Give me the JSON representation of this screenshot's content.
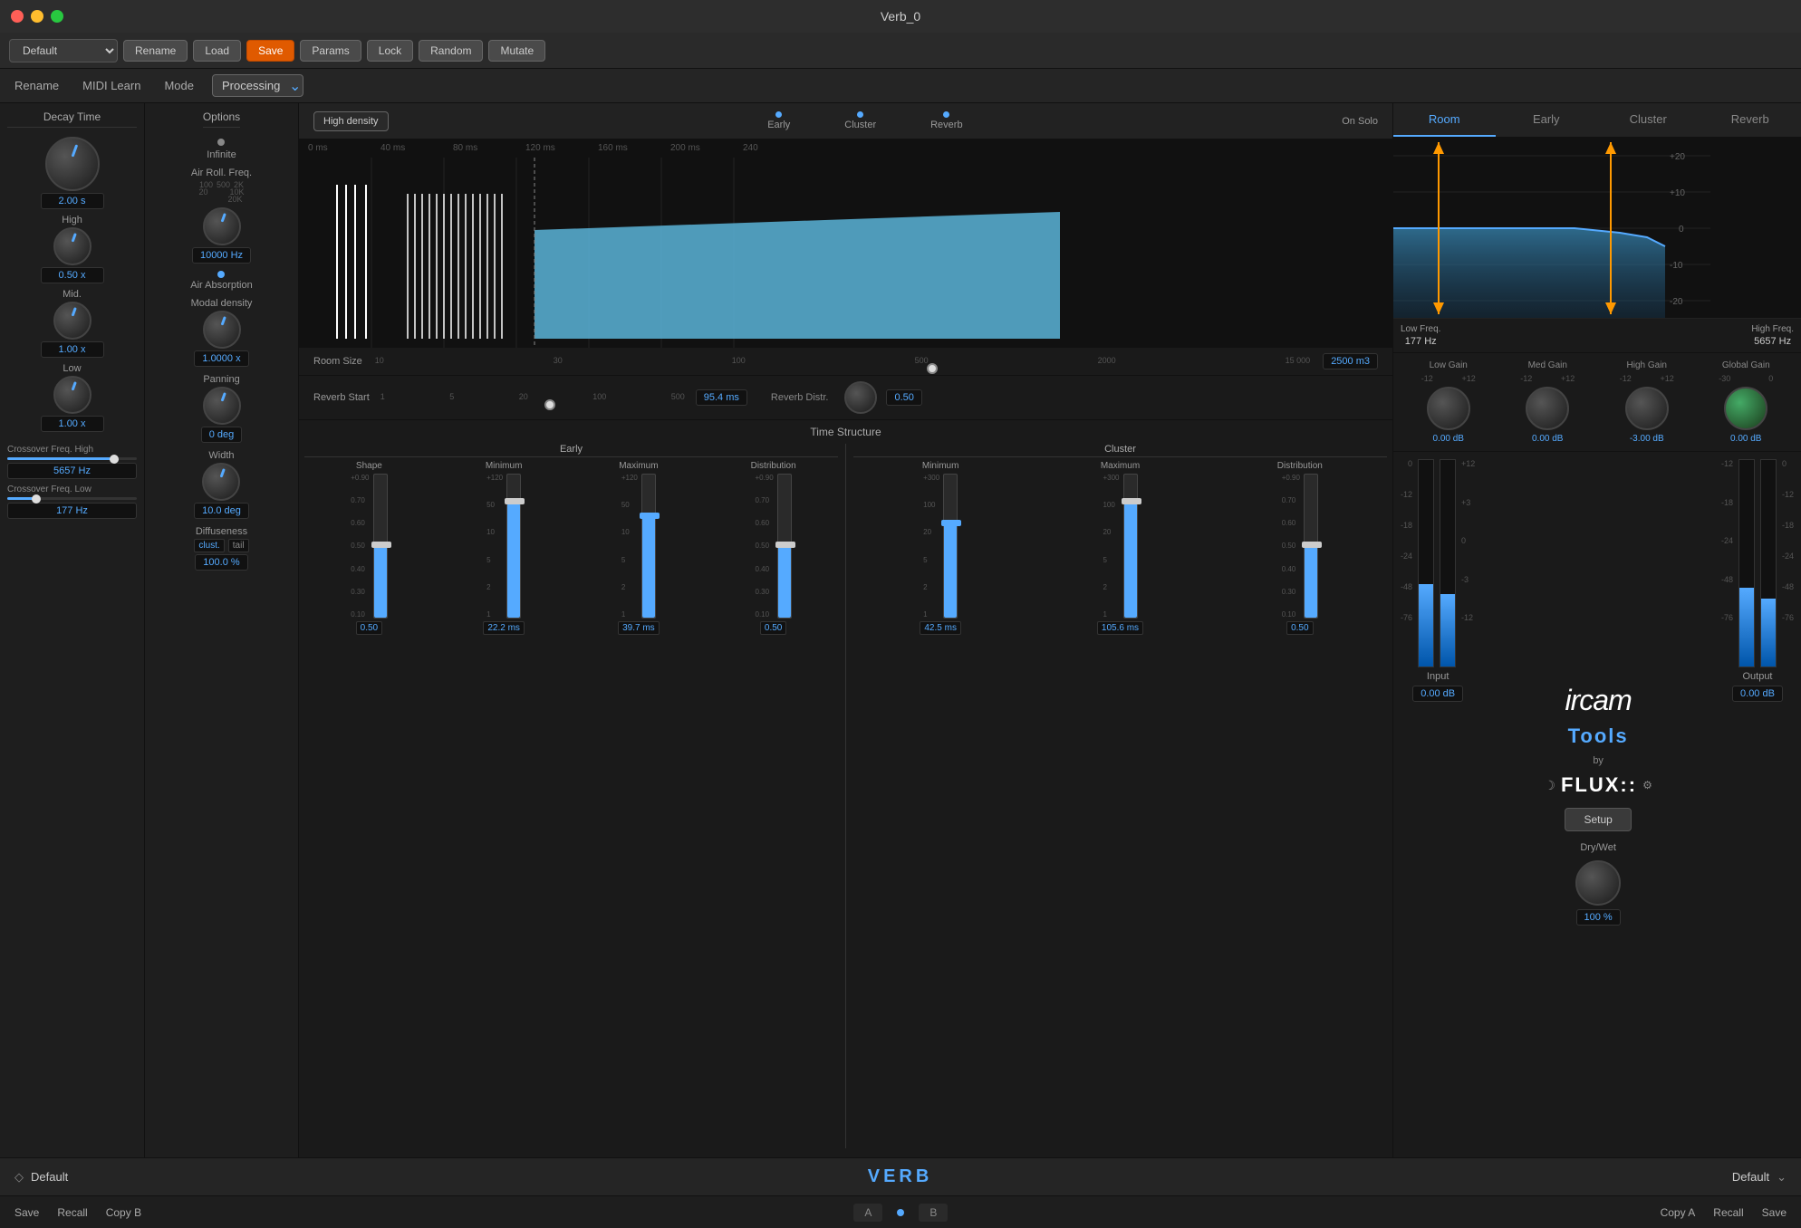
{
  "window": {
    "title": "Verb_0"
  },
  "toolbar": {
    "preset": "Default",
    "rename": "Rename",
    "load": "Load",
    "save": "Save",
    "params": "Params",
    "lock": "Lock",
    "random": "Random",
    "mutate": "Mutate"
  },
  "modebar": {
    "rename": "Rename",
    "midi_learn": "MIDI Learn",
    "mode_label": "Mode",
    "mode_value": "Processing"
  },
  "decay": {
    "title": "Decay Time",
    "knobs": [
      {
        "label": "",
        "value": "2.00 s"
      },
      {
        "label": "High",
        "value": "0.50 x"
      },
      {
        "label": "Mid.",
        "value": "1.00 x"
      },
      {
        "label": "Low",
        "value": "1.00 x"
      }
    ],
    "crossover_high": {
      "label": "Crossover Freq. High",
      "value": "5657 Hz"
    },
    "crossover_low": {
      "label": "Crossover Freq. Low",
      "value": "177 Hz"
    }
  },
  "options": {
    "title": "Options",
    "infinite": "Infinite",
    "air_roll_freq": {
      "label": "Air Roll. Freq.",
      "value": "10000 Hz"
    },
    "air_absorption": "Air Absorption",
    "modal_density": "Modal density",
    "modal_value": "1.0000 x",
    "panning": {
      "label": "Panning",
      "value": "0 deg"
    },
    "width": {
      "label": "Width",
      "value": "10.0 deg"
    },
    "diffuseness": {
      "label": "Diffuseness",
      "values": [
        "clust.",
        "tail"
      ]
    },
    "diffuseness_value": "100.0 %"
  },
  "visualization": {
    "high_density": "High density",
    "tabs": [
      "Early",
      "Cluster",
      "Reverb"
    ],
    "on_solo": "On Solo",
    "time_marks": [
      "0 ms",
      "40 ms",
      "80 ms",
      "120 ms",
      "160 ms",
      "200 ms",
      "240"
    ],
    "room_size": {
      "label": "Room Size",
      "value": "2500 m3",
      "scale": [
        "10",
        "30",
        "100",
        "500",
        "2000",
        "15 000"
      ]
    },
    "reverb_start": {
      "label": "Reverb Start",
      "value": "95.4 ms"
    },
    "reverb_distr": {
      "label": "Reverb Distr.",
      "value": "0.50"
    }
  },
  "time_structure": {
    "title": "Time Structure",
    "early": {
      "title": "Early",
      "cols": [
        {
          "label": "Shape",
          "value": "0.50",
          "marks": [
            "+0.90",
            "0.70",
            "0.60",
            "0.50",
            "0.40",
            "0.30",
            "0.10"
          ]
        },
        {
          "label": "Minimum",
          "value": "22.2 ms",
          "marks": [
            "+120",
            "50",
            "10",
            "5",
            "2",
            "1"
          ]
        },
        {
          "label": "Maximum",
          "value": "39.7 ms",
          "marks": [
            "+120",
            "50",
            "10",
            "5",
            "2",
            "1"
          ]
        },
        {
          "label": "Distribution",
          "value": "0.50",
          "marks": [
            "+0.90",
            "0.70",
            "0.60",
            "0.50",
            "0.40",
            "0.30",
            "0.10"
          ]
        }
      ]
    },
    "cluster": {
      "title": "Cluster",
      "cols": [
        {
          "label": "Minimum",
          "value": "42.5 ms",
          "marks": [
            "+300",
            "100",
            "20",
            "5",
            "2",
            "1"
          ]
        },
        {
          "label": "Maximum",
          "value": "105.6 ms",
          "marks": [
            "+300",
            "100",
            "20",
            "5",
            "2",
            "1"
          ]
        },
        {
          "label": "Distribution",
          "value": "0.50",
          "marks": [
            "+0.90",
            "0.70",
            "0.60",
            "0.50",
            "0.40",
            "0.30",
            "0.10"
          ]
        }
      ]
    }
  },
  "eq_panel": {
    "tabs": [
      "Room",
      "Early",
      "Cluster",
      "Reverb"
    ],
    "active_tab": "Room",
    "db_marks": [
      "+20",
      "+10",
      "0",
      "-10",
      "-20"
    ],
    "freq_labels": {
      "low": {
        "label": "Low Freq.",
        "value": "177 Hz"
      },
      "high": {
        "label": "High Freq.",
        "value": "5657 Hz"
      }
    },
    "gains": [
      {
        "label": "Low Gain",
        "value": "0.00 dB"
      },
      {
        "label": "Med Gain",
        "value": "0.00 dB"
      },
      {
        "label": "High Gain",
        "value": "-3.00 dB"
      },
      {
        "label": "Global Gain",
        "value": "0.00 dB"
      }
    ],
    "gain_ranges": [
      {
        "min": "-12",
        "max": "+12"
      },
      {
        "min": "-12",
        "max": "+12"
      },
      {
        "min": "-12",
        "max": "+12"
      },
      {
        "min": "-30",
        "max": "0"
      }
    ]
  },
  "ircam": {
    "brand": "ircam",
    "tools": "Tools",
    "by": "by",
    "flux": "FLUX::",
    "setup": "Setup",
    "drywet_label": "Dry/Wet",
    "drywet_value": "100 %"
  },
  "io": {
    "input_label": "Input",
    "input_value": "0.00 dB",
    "output_label": "Output",
    "output_value": "0.00 dB",
    "vu_marks": [
      "0",
      "-12",
      "-18",
      "-24",
      "-48",
      "-76"
    ],
    "side_marks": [
      "+12",
      "+3",
      "0",
      "-3",
      "-12"
    ],
    "vu_marks_right": [
      "0",
      "-12",
      "-18",
      "-24",
      "-48",
      "-76"
    ]
  },
  "bottom_bar": {
    "left_preset": "Default",
    "center_title": "VERB",
    "right_preset": "Default"
  },
  "footer": {
    "save": "Save",
    "recall": "Recall",
    "copy_b": "Copy B",
    "copy_a": "Copy A",
    "recall_r": "Recall",
    "save_r": "Save",
    "a_label": "A",
    "b_label": "B"
  }
}
